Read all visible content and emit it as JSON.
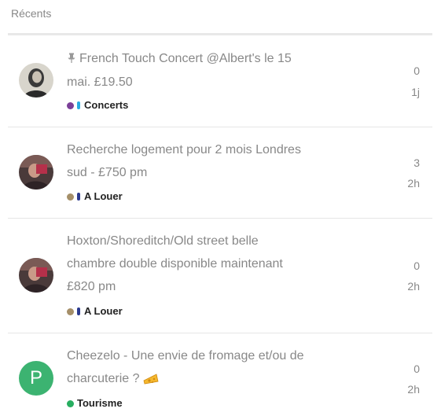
{
  "header": {
    "title": "Récents"
  },
  "topics": [
    {
      "title_line1": "French Touch Concert @Albert's le 15",
      "title_line2": "mai. £19.50",
      "pinned": true,
      "category": {
        "name": "Concerts",
        "dot_color": "#7b3f98",
        "bar_color": "#29abe2"
      },
      "replies": "0",
      "age": "1j",
      "avatar": "photo-woman"
    },
    {
      "title_line1": "Recherche logement pour 2 mois Londres",
      "title_line2": "sud - £750 pm",
      "pinned": false,
      "category": {
        "name": "A Louer",
        "dot_color": "#a58f69",
        "bar_color": "#2b3a8f"
      },
      "replies": "3",
      "age": "2h",
      "avatar": "photo-man"
    },
    {
      "title_line1": "Hoxton/Shoreditch/Old street belle",
      "title_line2": "chambre double disponible maintenant",
      "title_line3": "£820 pm",
      "pinned": false,
      "category": {
        "name": "A Louer",
        "dot_color": "#a58f69",
        "bar_color": "#2b3a8f"
      },
      "replies": "0",
      "age": "2h",
      "avatar": "photo-man"
    },
    {
      "title_line1": "Cheezelo - Une envie de fromage et/ou de",
      "title_line2": "charcuterie ?",
      "pinned": false,
      "category": {
        "name": "Tourisme",
        "dot_color": "#27ae60"
      },
      "replies": "0",
      "age": "2h",
      "avatar_letter": "P",
      "avatar_color": "#3cb371"
    }
  ]
}
